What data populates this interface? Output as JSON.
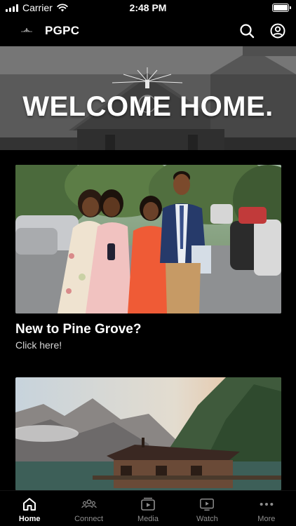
{
  "status_bar": {
    "carrier": "Carrier",
    "time": "2:48 PM",
    "battery_level": 1.0
  },
  "header": {
    "title": "PGPC",
    "icons": [
      "church-logo-icon",
      "search-icon",
      "account-icon"
    ]
  },
  "hero": {
    "title": "WELCOME HOME."
  },
  "cards": [
    {
      "title": "New to Pine Grove?",
      "subtitle": "Click here!",
      "image": "group-photo-four-people"
    },
    {
      "title": "",
      "subtitle": "",
      "image": "mountain-lake-cabin"
    }
  ],
  "tab_bar": {
    "active": "Home",
    "tabs": [
      {
        "label": "Home",
        "icon": "home-icon"
      },
      {
        "label": "Connect",
        "icon": "people-icon"
      },
      {
        "label": "Media",
        "icon": "media-icon"
      },
      {
        "label": "Watch",
        "icon": "play-icon"
      },
      {
        "label": "More",
        "icon": "more-icon"
      }
    ]
  },
  "colors": {
    "background": "#000000",
    "text": "#ffffff",
    "inactive_tab": "#8e8e8e"
  }
}
